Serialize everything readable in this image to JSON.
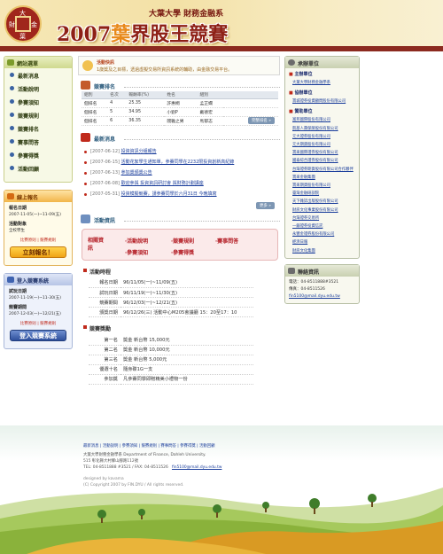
{
  "header": {
    "school": "大葉大學 財務金融系",
    "title_prefix": "2007",
    "title_highlight": "葉",
    "title_suffix": "界股王競賽",
    "logo_chars": [
      "大",
      "財",
      "金",
      "葉"
    ]
  },
  "left": {
    "menu_title": "網站選單",
    "menu": [
      "最新消息",
      "活動說明",
      "參賽須知",
      "競賽規則",
      "競賽排名",
      "賽事問答",
      "參賽得獎",
      "活動回顧"
    ],
    "signup": {
      "title": "線上報名",
      "label": "報名日期",
      "date": "2007-11-05(一)~11-09(五)",
      "note_label": "活動對象",
      "note": "全校學生",
      "links": "比賽原則 | 競賽規則",
      "button": "立刻報名！"
    },
    "login": {
      "title": "登入競賽系統",
      "label1": "試玩日期",
      "date1": "2007-11-19(一)~11-30(五)",
      "label2": "競賽期間",
      "date2": "2007-12-03(一)~12/21(五)",
      "links": "比賽原則 | 競賽規則",
      "button": "登入競賽系統"
    }
  },
  "center": {
    "notice": {
      "title": "活動快訊",
      "text": "1歲獎及之目標，透過虛擬交易所資訊系統的輔助，由金融交易平台。"
    },
    "rank": {
      "title": "競賽排名",
      "headers": [
        "組別",
        "名次",
        "報酬率(%)",
        "姓名",
        "組別",
        "名次"
      ],
      "rows": [
        [
          "個排名",
          "4",
          "25.35",
          "許惠桐",
          "孟芷嫻"
        ],
        [
          "個排名",
          "5",
          "34.95",
          "小劉P",
          "戴德宏"
        ],
        [
          "個排名",
          "6",
          "36.35",
          "閻雅之男",
          "馬郁志"
        ]
      ],
      "more": "完整排名 »"
    },
    "news": {
      "title": "最新消息",
      "items": [
        {
          "date": "[2007-06-12]",
          "text": "投資資訊分組報告"
        },
        {
          "date": "[2007-06-15]",
          "text": "活動花絮學生通知單，參賽同學在2232限投資創新高紀錄"
        },
        {
          "date": "[2007-06-13]",
          "text": "參加獎頒獎公告"
        },
        {
          "date": "[2007-06-08]",
          "text": "歡迎參與 投資資訊研討會 與財務計劃講座"
        },
        {
          "date": "[2007-05-31]",
          "text": "投資模擬競賽，請參賽同學於六月31日 今晚填寫"
        }
      ],
      "more": "更多 »"
    },
    "activity": {
      "title": "活動資訊",
      "label": "相關資訊",
      "items": [
        "活動說明",
        "競賽規則",
        "賽事問答",
        "參賽須知",
        "參賽得獎"
      ]
    },
    "schedule": {
      "title": "活動時程",
      "rows": [
        [
          "報名日期",
          "96/11/05(一)~11/09(五)"
        ],
        [
          "試玩日期",
          "96/11/19(一)~11/30(五)"
        ],
        [
          "競賽期間",
          "96/12/03(一)~12/21(五)"
        ],
        [
          "頒獎日期",
          "96/12/26(三) 活動中心M205會議廳 15：20至17：10"
        ]
      ]
    },
    "prize": {
      "title": "競賽獎勵",
      "rows": [
        [
          "第一名",
          "獎金 新台幣 15,000元"
        ],
        [
          "第二名",
          "獎金 新台幣 10,000元"
        ],
        [
          "第三名",
          "獎金 新台幣 5,000元"
        ],
        [
          "優選十名",
          "隨身碟1G一支"
        ],
        [
          "參加獎",
          "凡參賽同學即贈精美小禮物一份"
        ]
      ]
    }
  },
  "right": {
    "title": "承辦單位",
    "groups": [
      {
        "name": "主辦單位",
        "items": [
          "大葉大學財務金融學系"
        ]
      },
      {
        "name": "協辦單位",
        "items": [
          "寶城證券投資顧問股份有限公司"
        ]
      },
      {
        "name": "贊助單位",
        "items": [
          "富邦國際股份有限公司",
          "凱基人壽保險股份有限公司",
          "元大證券股份有限公司",
          "元大期貨股份有限公司",
          "寶來國際證券股份有限公司",
          "國泰綜合證券股份有限公司",
          "台灣證券期貨股份有限公司合作夥伴",
          "寶來金融集團",
          "寶來期貨股份有限公司",
          "臺灣金融研訓院",
          "天下雜誌出版股份有限公司",
          "財訊文化事業股份有限公司",
          "台灣證券交易所",
          "一銀證券投資信託",
          "永豐金證券股份有限公司",
          "經濟日報",
          "財訊文化集團"
        ]
      }
    ],
    "contact": {
      "title": "聯絡資訊",
      "phone": "電話：04-8511888#3521",
      "fax": "傳真：04-8511526",
      "email": "fin5100@mail.dyu.edu.tw"
    }
  },
  "footer": {
    "links": "最新消息 | 活動說明 | 參賽須知 | 競賽規則 | 賽事問答 | 參賽得獎 | 活動回顧",
    "addr1": "大葉大學財務金融學系 Department of Finance, Dahleh University.",
    "addr2": "515 彰化縣大村鄉山腳路112號",
    "tel": "TEL: 04-8511888 #3521 / FAX: 04-8511526",
    "mail": "fin5100@mail.dyu.edu.tw",
    "designer": "designed by kavama",
    "copy": "(C) Copyright 2007 by FIN.DYU / All rights reserved."
  }
}
